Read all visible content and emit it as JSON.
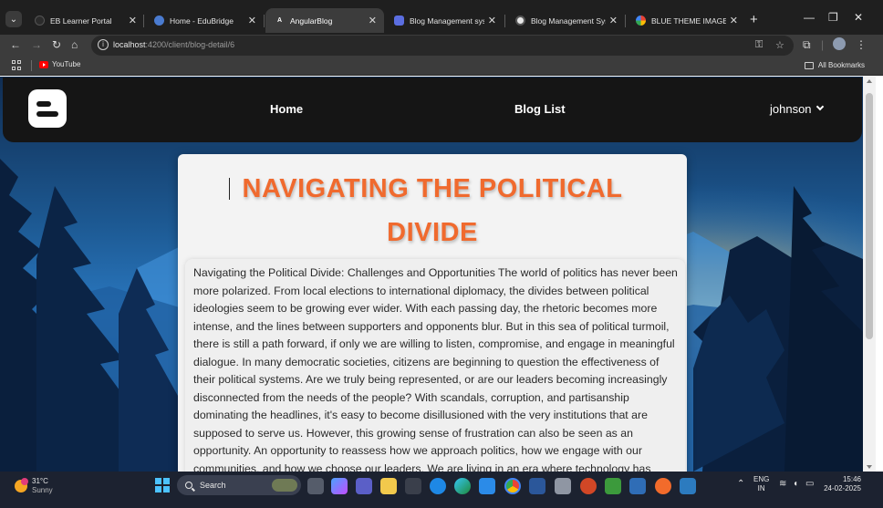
{
  "browser": {
    "tabs": [
      {
        "title": "EB Learner Portal",
        "active": false,
        "favicon_color": "#1f1f1f"
      },
      {
        "title": "Home - EduBridge",
        "active": false,
        "favicon_color": "#4a7bd0"
      },
      {
        "title": "AngularBlog",
        "active": true,
        "favicon_color": "#dd0031"
      },
      {
        "title": "Blog Management system",
        "active": false,
        "favicon_color": "#5b6ee1"
      },
      {
        "title": "Blog Management System",
        "active": false,
        "favicon_color": "#e8e8e8"
      },
      {
        "title": "BLUE THEME IMAGE OG H",
        "active": false,
        "favicon_color": "#4285f4"
      }
    ],
    "url": {
      "host": "localhost",
      "path": ":4200/client/blog-detail/6"
    },
    "bookmarks": {
      "youtube_label": "YouTube",
      "all_label": "All Bookmarks"
    }
  },
  "app": {
    "nav": {
      "home_label": "Home",
      "bloglist_label": "Blog List",
      "user_label": "johnson"
    },
    "post": {
      "title": "NAVIGATING THE POLITICAL DIVIDE",
      "body": "Navigating the Political Divide: Challenges and Opportunities The world of politics has never been more polarized. From local elections to international diplomacy, the divides between political ideologies seem to be growing ever wider. With each passing day, the rhetoric becomes more intense, and the lines between supporters and opponents blur. But in this sea of political turmoil, there is still a path forward, if only we are willing to listen, compromise, and engage in meaningful dialogue. In many democratic societies, citizens are beginning to question the effectiveness of their political systems. Are we truly being represented, or are our leaders becoming increasingly disconnected from the needs of the people? With scandals, corruption, and partisanship dominating the headlines, it's easy to become disillusioned with the very institutions that are supposed to serve us. However, this growing sense of frustration can also be seen as an opportunity. An opportunity to reassess how we approach politics, how we engage with our communities, and how we choose our leaders. We are living in an era where technology has"
    }
  },
  "taskbar": {
    "weather_temp": "31°C",
    "weather_text": "Sunny",
    "search_label": "Search",
    "lang_top": "ENG",
    "lang_bottom": "IN",
    "time": "15:46",
    "date": "24-02-2025"
  },
  "colors": {
    "accent_title": "#f06a2e",
    "navbar_bg": "#151515",
    "card_bg": "#f3f3f3"
  }
}
